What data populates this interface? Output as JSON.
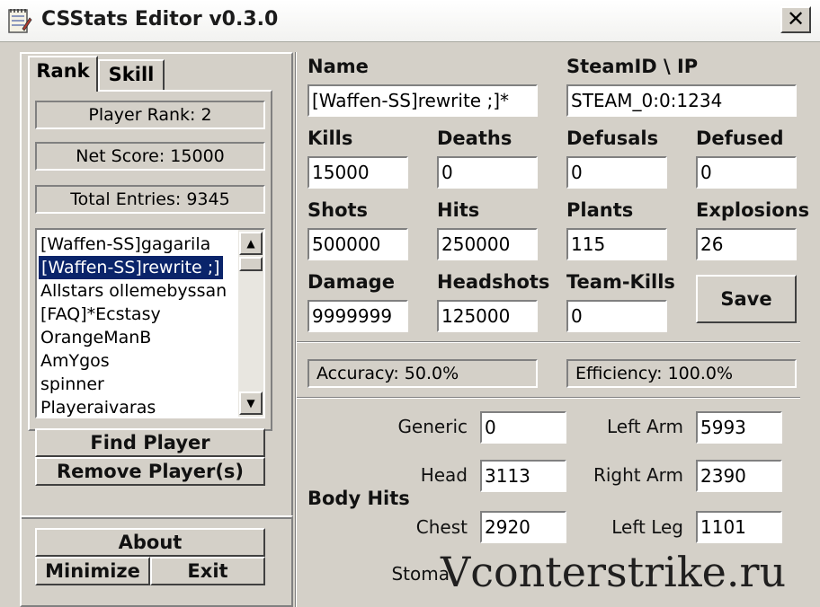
{
  "window": {
    "title": "CSStats Editor v0.3.0",
    "close_glyph": "✕"
  },
  "tabs": [
    {
      "label": "Rank"
    },
    {
      "label": "Skill"
    }
  ],
  "rank": {
    "player_rank": "Player Rank: 2",
    "net_score": "Net Score: 15000",
    "total_entries": "Total Entries: 9345"
  },
  "players": [
    {
      "name": "[Waffen-SS]gagarila",
      "selected": false
    },
    {
      "name": "[Waffen-SS]rewrite ;]",
      "selected": true
    },
    {
      "name": "Allstars ollemebyssan",
      "selected": false
    },
    {
      "name": "[FAQ]*Ecstasy",
      "selected": false
    },
    {
      "name": "OrangeManB",
      "selected": false
    },
    {
      "name": "AmYgos",
      "selected": false
    },
    {
      "name": "spinner",
      "selected": false
    },
    {
      "name": "Playeraivaras",
      "selected": false
    }
  ],
  "scrollbar": {
    "up_icon": "▲",
    "down_icon": "▼"
  },
  "left_buttons": {
    "find_player": "Find Player",
    "remove_players": "Remove Player(s)",
    "about": "About",
    "minimize": "Minimize",
    "exit": "Exit"
  },
  "fields": {
    "name": {
      "label": "Name",
      "value": "[Waffen-SS]rewrite ;]*"
    },
    "steamid": {
      "label": "SteamID \\ IP",
      "value": "STEAM_0:0:1234"
    },
    "kills": {
      "label": "Kills",
      "value": "15000"
    },
    "deaths": {
      "label": "Deaths",
      "value": "0"
    },
    "defusals": {
      "label": "Defusals",
      "value": "0"
    },
    "defused": {
      "label": "Defused",
      "value": "0"
    },
    "shots": {
      "label": "Shots",
      "value": "500000"
    },
    "hits": {
      "label": "Hits",
      "value": "250000"
    },
    "plants": {
      "label": "Plants",
      "value": "115"
    },
    "explosions": {
      "label": "Explosions",
      "value": "26"
    },
    "damage": {
      "label": "Damage",
      "value": "9999999"
    },
    "headshots": {
      "label": "Headshots",
      "value": "125000"
    },
    "teamkills": {
      "label": "Team-Kills",
      "value": "0"
    }
  },
  "save_label": "Save",
  "accuracy": "Accuracy: 50.0%",
  "efficiency": "Efficiency: 100.0%",
  "body_hits": {
    "title": "Body Hits",
    "generic": {
      "label": "Generic",
      "value": "0"
    },
    "head": {
      "label": "Head",
      "value": "3113"
    },
    "chest": {
      "label": "Chest",
      "value": "2920"
    },
    "stomach": {
      "label": "Stoma"
    },
    "left_arm": {
      "label": "Left Arm",
      "value": "5993"
    },
    "right_arm": {
      "label": "Right Arm",
      "value": "2390"
    },
    "left_leg": {
      "label": "Left Leg",
      "value": "1101"
    }
  },
  "watermark": "Vconterstrike.ru"
}
